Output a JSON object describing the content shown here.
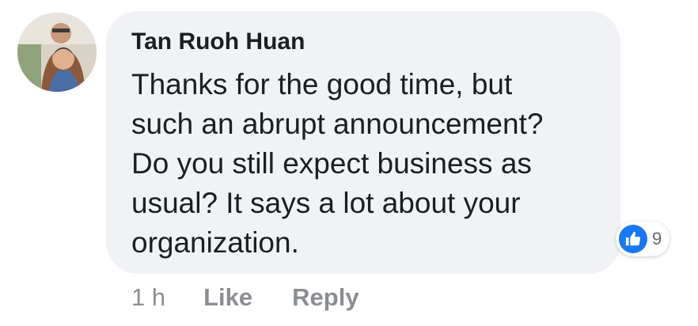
{
  "comment": {
    "author": "Tan Ruoh Huan",
    "text_lines": [
      "Thanks for the good time, but",
      "such an abrupt announcement?",
      "Do you still expect business as",
      "usual? It says a lot about your",
      "organization."
    ],
    "reactions": {
      "icon": "thumbs-up-icon",
      "count": "9",
      "color": "#1877f2"
    },
    "actions": {
      "time": "1 h",
      "like_label": "Like",
      "reply_label": "Reply"
    }
  }
}
